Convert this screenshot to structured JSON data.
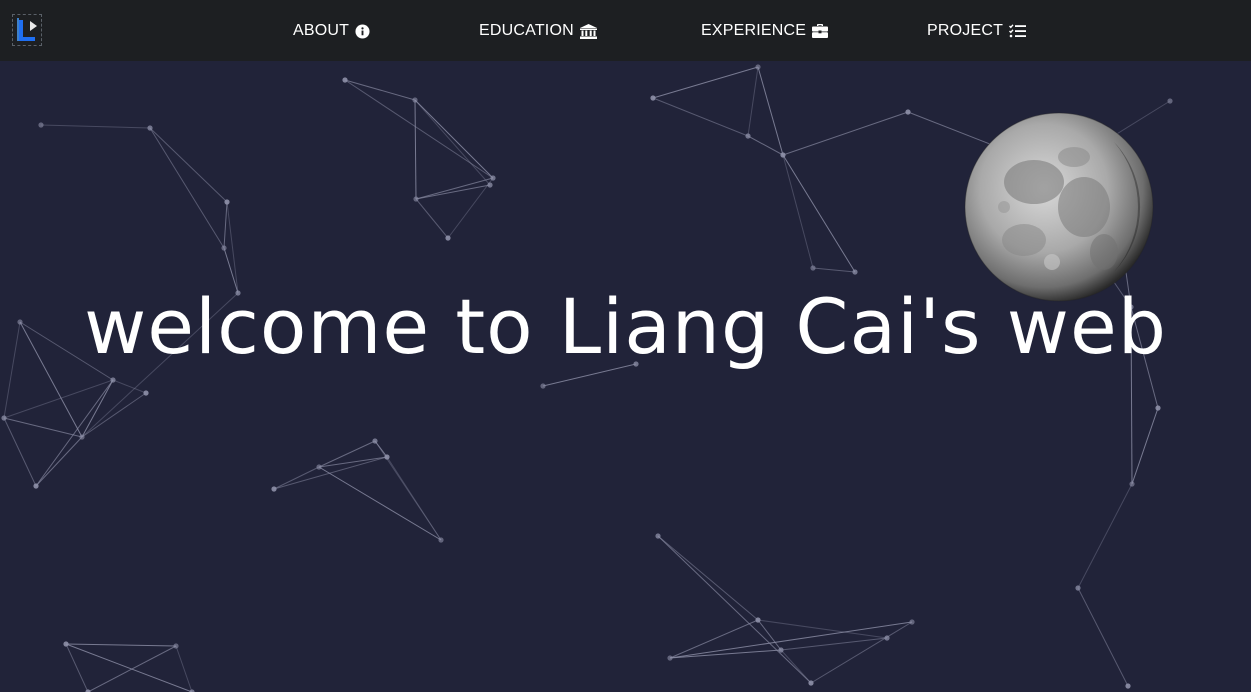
{
  "navbar": {
    "logo_icon": "liang-cai-logo-icon",
    "items": [
      {
        "label": "ABOUT",
        "icon": "info-circle-icon"
      },
      {
        "label": "EDUCATION",
        "icon": "university-icon"
      },
      {
        "label": "EXPERIENCE",
        "icon": "briefcase-icon"
      },
      {
        "label": "PROJECT",
        "icon": "tasks-list-icon"
      }
    ]
  },
  "hero": {
    "title": "welcome to Liang Cai's web"
  },
  "background": {
    "color": "#212339",
    "navbar_color": "#1d1f22",
    "network_color": "#8e90a8",
    "moon_icon": "moon-icon"
  }
}
